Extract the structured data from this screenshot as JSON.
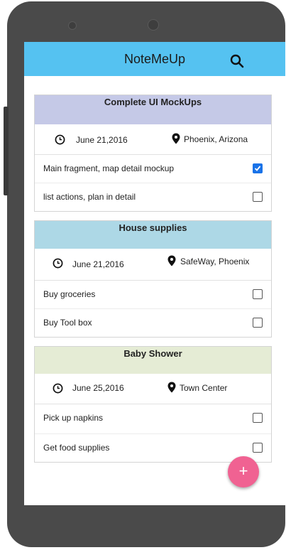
{
  "app": {
    "title": "NoteMeUp",
    "accent": "#55c2f1"
  },
  "cards": [
    {
      "title": "Complete UI MockUps",
      "header_color": "#c5c9e7",
      "date": "June 21,2016",
      "location": "Phoenix, Arizona",
      "tasks": [
        {
          "label": "Main fragment, map detail mockup",
          "checked": true
        },
        {
          "label": "list actions, plan in detail",
          "checked": false
        }
      ]
    },
    {
      "title": "House supplies",
      "header_color": "#add8e6",
      "date": "June 21,2016",
      "location": "SafeWay, Phoenix",
      "tasks": [
        {
          "label": "Buy groceries",
          "checked": false
        },
        {
          "label": "Buy Tool box",
          "checked": false
        }
      ]
    },
    {
      "title": "Baby Shower",
      "header_color": "#e5ecd5",
      "date": "June 25,2016",
      "location": "Town Center",
      "tasks": [
        {
          "label": "Pick up napkins",
          "checked": false
        },
        {
          "label": "Get food supplies",
          "checked": false
        }
      ]
    }
  ],
  "fab": {
    "label": "+",
    "color": "#f06292"
  }
}
